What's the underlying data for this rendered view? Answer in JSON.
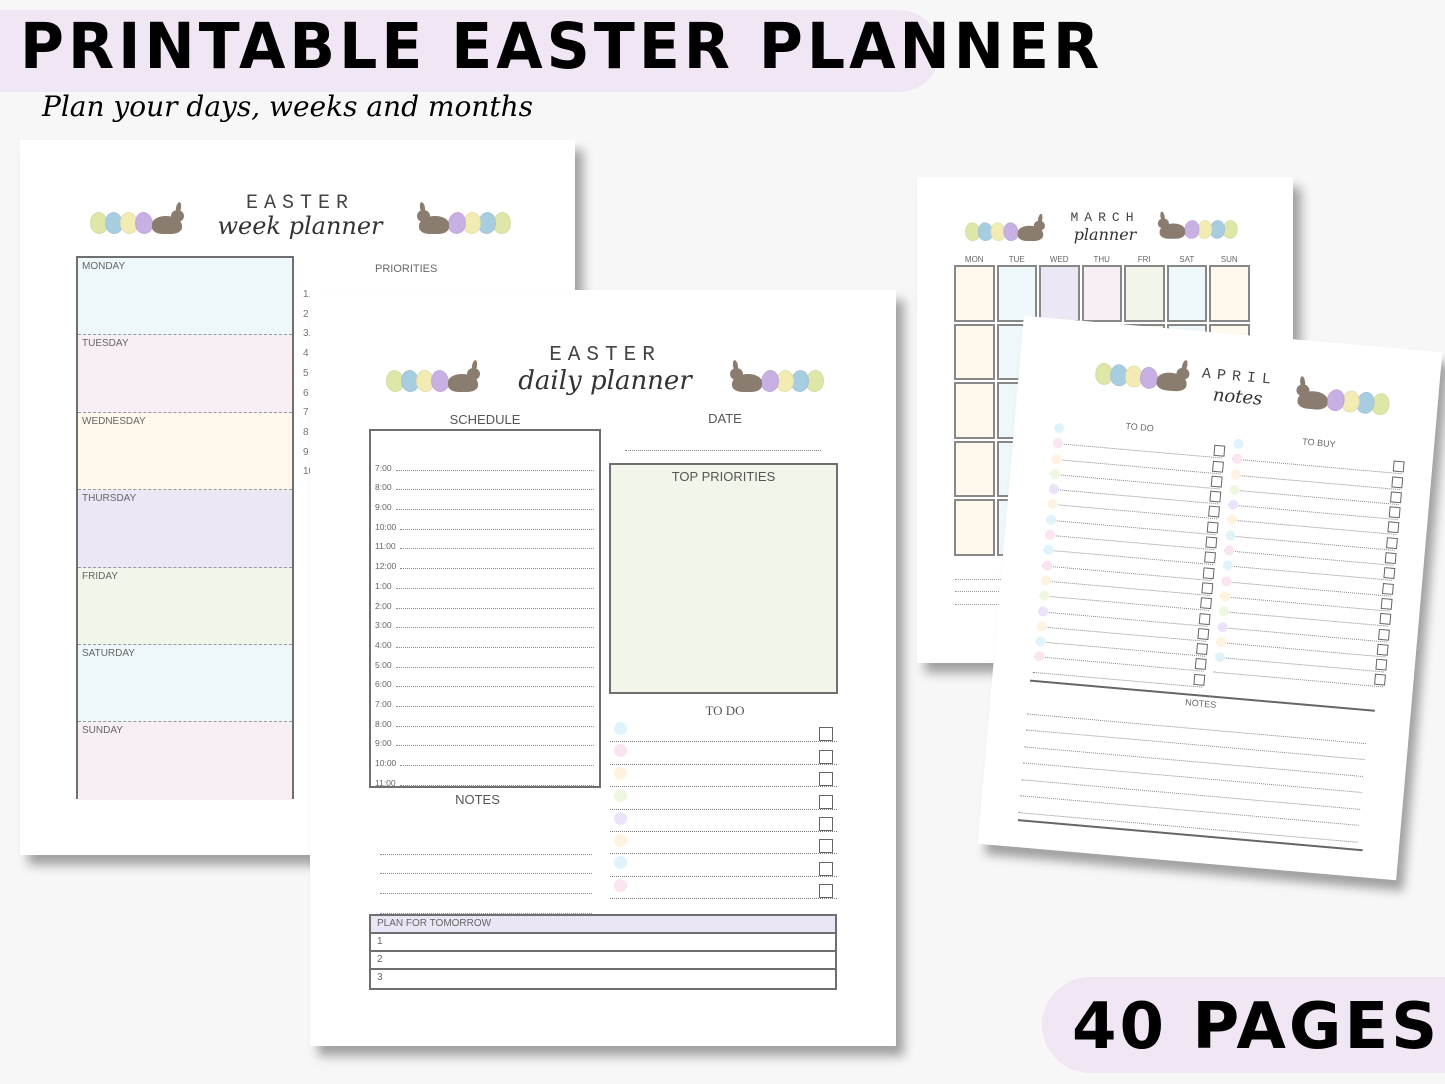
{
  "banner": {
    "title": "PRINTABLE EASTER PLANNER",
    "subtitle": "Plan your days, weeks and months",
    "page_count_label": "40 PAGES",
    "pill_color": "#f1e6f3"
  },
  "palette": {
    "egg_colors": [
      "#dfe7a8",
      "#a9cde0",
      "#f2ecb4",
      "#c9b0e4"
    ],
    "egg_colors_right": [
      "#e3b9d8",
      "#f2ecb4",
      "#a9cde0",
      "#dfe7a8"
    ],
    "dot_colors": [
      "#dff3fb",
      "#fbe3f2",
      "#fff3df",
      "#eef8e0",
      "#ece3fb",
      "#fff3df",
      "#dff3fb",
      "#fbe3f2"
    ]
  },
  "week_planner": {
    "header_top": "EASTER",
    "header_script": "week planner",
    "days": [
      {
        "label": "MONDAY",
        "color": "#eef7fa"
      },
      {
        "label": "TUESDAY",
        "color": "#f8eef6"
      },
      {
        "label": "WEDNESDAY",
        "color": "#fff8ec"
      },
      {
        "label": "THURSDAY",
        "color": "#ece7f5"
      },
      {
        "label": "FRIDAY",
        "color": "#f2f6ea"
      },
      {
        "label": "SATURDAY",
        "color": "#eef7fa"
      },
      {
        "label": "SUNDAY",
        "color": "#f8eef6"
      }
    ],
    "priorities_label": "PRIORITIES",
    "priority_numbers": [
      "1.",
      "2",
      "3.",
      "4",
      "5",
      "6",
      "7",
      "8",
      "9",
      "10"
    ]
  },
  "daily_planner": {
    "header_top": "EASTER",
    "header_script": "daily planner",
    "schedule_label": "SCHEDULE",
    "date_label": "DATE",
    "top_priorities_label": "TOP PRIORITIES",
    "todo_label": "TO DO",
    "notes_label": "NOTES",
    "times": [
      "7:00",
      "8:00",
      "9:00",
      "10:00",
      "11:00",
      "12:00",
      "1:00",
      "2:00",
      "3:00",
      "4:00",
      "5:00",
      "6:00",
      "7:00",
      "8:00",
      "9:00",
      "10:00",
      "11:00"
    ],
    "plan_for_tomorrow": {
      "header": "PLAN FOR TOMORROW",
      "rows": [
        "1",
        "2",
        "3"
      ]
    }
  },
  "march_planner": {
    "header_top": "MARCH",
    "header_script": "planner",
    "weekdays": [
      "MON",
      "TUE",
      "WED",
      "THU",
      "FRI",
      "SAT",
      "SUN"
    ],
    "column_colors": [
      "#fff8ec",
      "#eef7fa",
      "#ece7f5",
      "#f8eef6",
      "#f2f6ea",
      "#eef7fa",
      "#fff8ec"
    ]
  },
  "april_notes": {
    "header_top": "APRIL",
    "header_script": "notes",
    "todo_label": "TO DO",
    "tobuy_label": "TO BUY",
    "notes_label": "NOTES"
  }
}
